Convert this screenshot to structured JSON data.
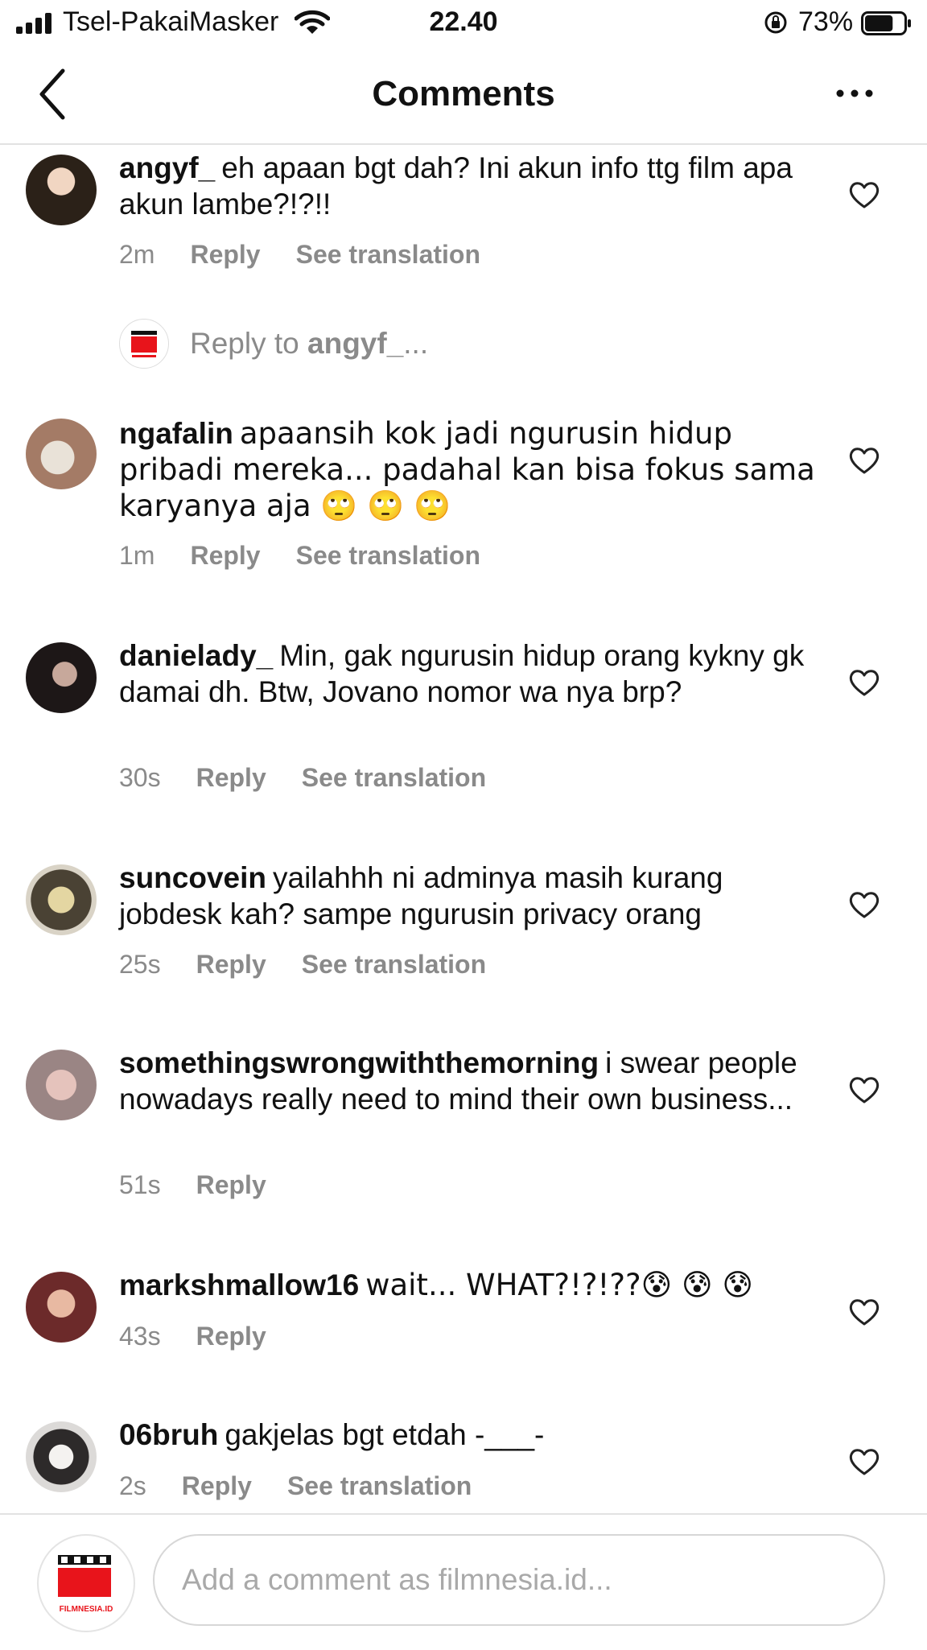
{
  "status_bar": {
    "carrier": "Tsel-PakaiMasker",
    "time": "22.40",
    "battery": "73%",
    "battery_level": 0.73
  },
  "header": {
    "title": "Comments",
    "back_icon": "chevron-left-icon",
    "more_icon": "more-horizontal-icon"
  },
  "comments": [
    {
      "username": "angyf_",
      "text": "eh apaan bgt dah? Ini akun info ttg film apa akun lambe?!?!!",
      "time": "2m",
      "reply": "Reply",
      "translate": "See translation"
    },
    {
      "username": "ngafalin",
      "text": "apaansih kok jadi ngurusin hidup pribadi mereka... padahal kan bisa fokus sama karyanya aja 🙄 🙄 🙄",
      "time": "1m",
      "reply": "Reply",
      "translate": "See translation"
    },
    {
      "username": "danielady_",
      "text": "Min, gak ngurusin hidup orang kykny gk damai  dh. Btw, Jovano nomor wa nya brp?",
      "time": "30s",
      "reply": "Reply",
      "translate": "See translation"
    },
    {
      "username": "suncovein",
      "text": "yailahhh ni adminya masih kurang jobdesk kah? sampe ngurusin privacy orang",
      "time": "25s",
      "reply": "Reply",
      "translate": "See translation"
    },
    {
      "username": "somethingswrongwiththemorning",
      "text": "i swear people nowadays really need to mind their own business...",
      "time": "51s",
      "reply": "Reply",
      "translate": ""
    },
    {
      "username": "markshmallow16",
      "text": "wait... WHAT?!?!??😰 😰 😰",
      "time": "43s",
      "reply": "Reply",
      "translate": ""
    },
    {
      "username": "06bruh",
      "text": "gakjelas bgt etdah -___-",
      "time": "2s",
      "reply": "Reply",
      "translate": "See translation"
    }
  ],
  "reply_prompt": {
    "prefix": "Reply to ",
    "username": "angyf_",
    "suffix": "..."
  },
  "composer": {
    "placeholder": "Add a comment as filmnesia.id...",
    "avatar_label": "FILMNESIA.ID"
  },
  "colors": {
    "text": "#111111",
    "secondary": "#8a8a8a",
    "brand_red": "#e8141b",
    "divider": "#e2e2e2"
  }
}
